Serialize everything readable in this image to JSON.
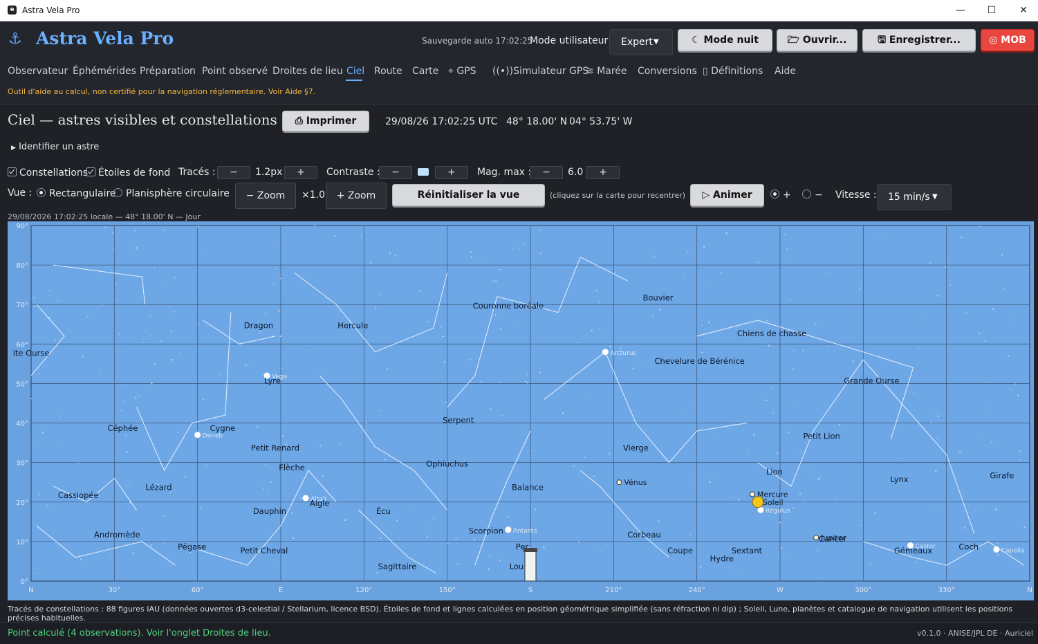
{
  "window": {
    "title": "Astra Vela Pro",
    "minimize": "—",
    "maximize": "☐",
    "close": "✕"
  },
  "header": {
    "brand": "Astra Vela Pro",
    "autosave": "Sauvegarde auto 17:02:25",
    "mode_label": "Mode utilisateur :",
    "mode_value": "Expert",
    "buttons": {
      "night": "Mode nuit",
      "open": "Ouvrir...",
      "save": "Enregistrer...",
      "mob": "MOB"
    }
  },
  "tabs": [
    "Observateur",
    "Éphémérides",
    "Préparation",
    "Point observé",
    "Droites de lieu",
    "Ciel",
    "Route",
    "Carte",
    "GPS",
    "Simulateur GPS",
    "Marée",
    "Conversions",
    "Définitions",
    "Aide"
  ],
  "active_tab": "Ciel",
  "warning": "Outil d'aide au calcul, non certifié pour la navigation réglementaire. Voir Aide §7.",
  "sky": {
    "title": "Ciel — astres visibles et constellations",
    "print": "Imprimer",
    "datetime": "29/08/26 17:02:25 UTC",
    "lat": "48° 18.00' N",
    "lon": "04° 53.75' W",
    "identify": "Identifier un astre",
    "controls": {
      "constellations": "Constellations",
      "background_stars": "Étoiles de fond",
      "traces_label": "Tracés :",
      "traces_value": "1.2px",
      "contrast_label": "Contraste :",
      "mag_label": "Mag. max :",
      "mag_value": "6.0",
      "minus": "−",
      "plus": "+"
    },
    "view": {
      "label": "Vue :",
      "rect": "Rectangulaire",
      "circular": "Planisphère circulaire",
      "zoom_out": "− Zoom",
      "zoom_value": "×1.0",
      "zoom_in": "+ Zoom",
      "reset": "Réinitialiser la vue",
      "hint": "(cliquez sur la carte pour recentrer)",
      "animate": "Animer",
      "speed_label": "Vitesse :",
      "speed_value": "15 min/s"
    },
    "chart_caption": "29/08/2026  17:02:25 locale  —  48° 18.00' N  —  Jour",
    "footnote": "Tracés de constellations : 88 figures IAU (données ouvertes d3-celestial / Stellarium, licence BSD). Étoiles de fond et lignes calculées en position géométrique simplifiée (sans réfraction ni dip) ; Soleil, Lune, planètes et catalogue de navigation utilisent les positions précises habituelles."
  },
  "chart_data": {
    "type": "scatter",
    "x_ticks": [
      "N",
      "30°",
      "60°",
      "E",
      "120°",
      "150°",
      "S",
      "210°",
      "240°",
      "W",
      "300°",
      "330°",
      "N"
    ],
    "y_ticks": [
      "0°",
      "10°",
      "20°",
      "30°",
      "40°",
      "50°",
      "60°",
      "70°",
      "80°",
      "90°"
    ],
    "xlim": [
      0,
      360
    ],
    "ylim": [
      0,
      90
    ],
    "grid": true,
    "constellations": [
      {
        "name": "ite Ourse",
        "az": 0,
        "alt": 57
      },
      {
        "name": "Dragon",
        "az": 82,
        "alt": 64
      },
      {
        "name": "Hercule",
        "az": 116,
        "alt": 64
      },
      {
        "name": "Couronne boréale",
        "az": 172,
        "alt": 69
      },
      {
        "name": "Bouvier",
        "az": 226,
        "alt": 71
      },
      {
        "name": "Chiens de chasse",
        "az": 267,
        "alt": 62
      },
      {
        "name": "Chevelure de Bérénice",
        "az": 241,
        "alt": 55
      },
      {
        "name": "Grande Ourse",
        "az": 303,
        "alt": 50
      },
      {
        "name": "Lyre",
        "az": 87,
        "alt": 50
      },
      {
        "name": "Céphée",
        "az": 33,
        "alt": 38
      },
      {
        "name": "Cygne",
        "az": 69,
        "alt": 38
      },
      {
        "name": "Serpent",
        "az": 154,
        "alt": 40
      },
      {
        "name": "Petit Lion",
        "az": 285,
        "alt": 36
      },
      {
        "name": "Petit Renard",
        "az": 88,
        "alt": 33
      },
      {
        "name": "Vierge",
        "az": 218,
        "alt": 33
      },
      {
        "name": "Ophiuchus",
        "az": 150,
        "alt": 29
      },
      {
        "name": "Flèche",
        "az": 94,
        "alt": 28
      },
      {
        "name": "Lion",
        "az": 268,
        "alt": 27
      },
      {
        "name": "Girafe",
        "az": 350,
        "alt": 26
      },
      {
        "name": "Lynx",
        "az": 313,
        "alt": 25
      },
      {
        "name": "Lézard",
        "az": 46,
        "alt": 23
      },
      {
        "name": "Balance",
        "az": 179,
        "alt": 23
      },
      {
        "name": "Cassiopée",
        "az": 17,
        "alt": 21
      },
      {
        "name": "Aigle",
        "az": 104,
        "alt": 19
      },
      {
        "name": "Dauphin",
        "az": 86,
        "alt": 17
      },
      {
        "name": "Écu",
        "az": 127,
        "alt": 17
      },
      {
        "name": "Scorpion",
        "az": 164,
        "alt": 12
      },
      {
        "name": "Andromède",
        "az": 31,
        "alt": 11
      },
      {
        "name": "Corbeau",
        "az": 221,
        "alt": 11
      },
      {
        "name": "Cancer",
        "az": 289,
        "alt": 10
      },
      {
        "name": "Pégase",
        "az": 58,
        "alt": 8
      },
      {
        "name": "Coupe",
        "az": 234,
        "alt": 7
      },
      {
        "name": "Sextant",
        "az": 258,
        "alt": 7
      },
      {
        "name": "Gémeaux",
        "az": 318,
        "alt": 7
      },
      {
        "name": "Coch",
        "az": 338,
        "alt": 8
      },
      {
        "name": "Petit Cheval",
        "az": 84,
        "alt": 7
      },
      {
        "name": "Hydre",
        "az": 249,
        "alt": 5
      },
      {
        "name": "Per",
        "az": 177,
        "alt": 8
      },
      {
        "name": "Sagittaire",
        "az": 132,
        "alt": 3
      },
      {
        "name": "Lou",
        "az": 175,
        "alt": 3
      }
    ],
    "bodies": [
      {
        "name": "Vénus",
        "az": 212,
        "alt": 25,
        "kind": "planet"
      },
      {
        "name": "Mercure",
        "az": 260,
        "alt": 22,
        "kind": "planet"
      },
      {
        "name": "Soleil",
        "az": 262,
        "alt": 20,
        "kind": "sun"
      },
      {
        "name": "Jupiter",
        "az": 283,
        "alt": 11,
        "kind": "planet"
      }
    ],
    "named_stars": [
      {
        "name": "Vega",
        "az": 85,
        "alt": 52
      },
      {
        "name": "Arcturus",
        "az": 207,
        "alt": 58
      },
      {
        "name": "Deneb",
        "az": 60,
        "alt": 37
      },
      {
        "name": "Altaïr",
        "az": 99,
        "alt": 21
      },
      {
        "name": "Antarès",
        "az": 172,
        "alt": 13
      },
      {
        "name": "Régulus",
        "az": 263,
        "alt": 18
      },
      {
        "name": "Castor",
        "az": 317,
        "alt": 9
      },
      {
        "name": "Capella",
        "az": 348,
        "alt": 8
      }
    ]
  },
  "status": {
    "left": "Point calculé (4 observations). Voir l'onglet Droites de lieu.",
    "right": "v0.1.0 · ANISE/JPL DE · Auriciel"
  }
}
